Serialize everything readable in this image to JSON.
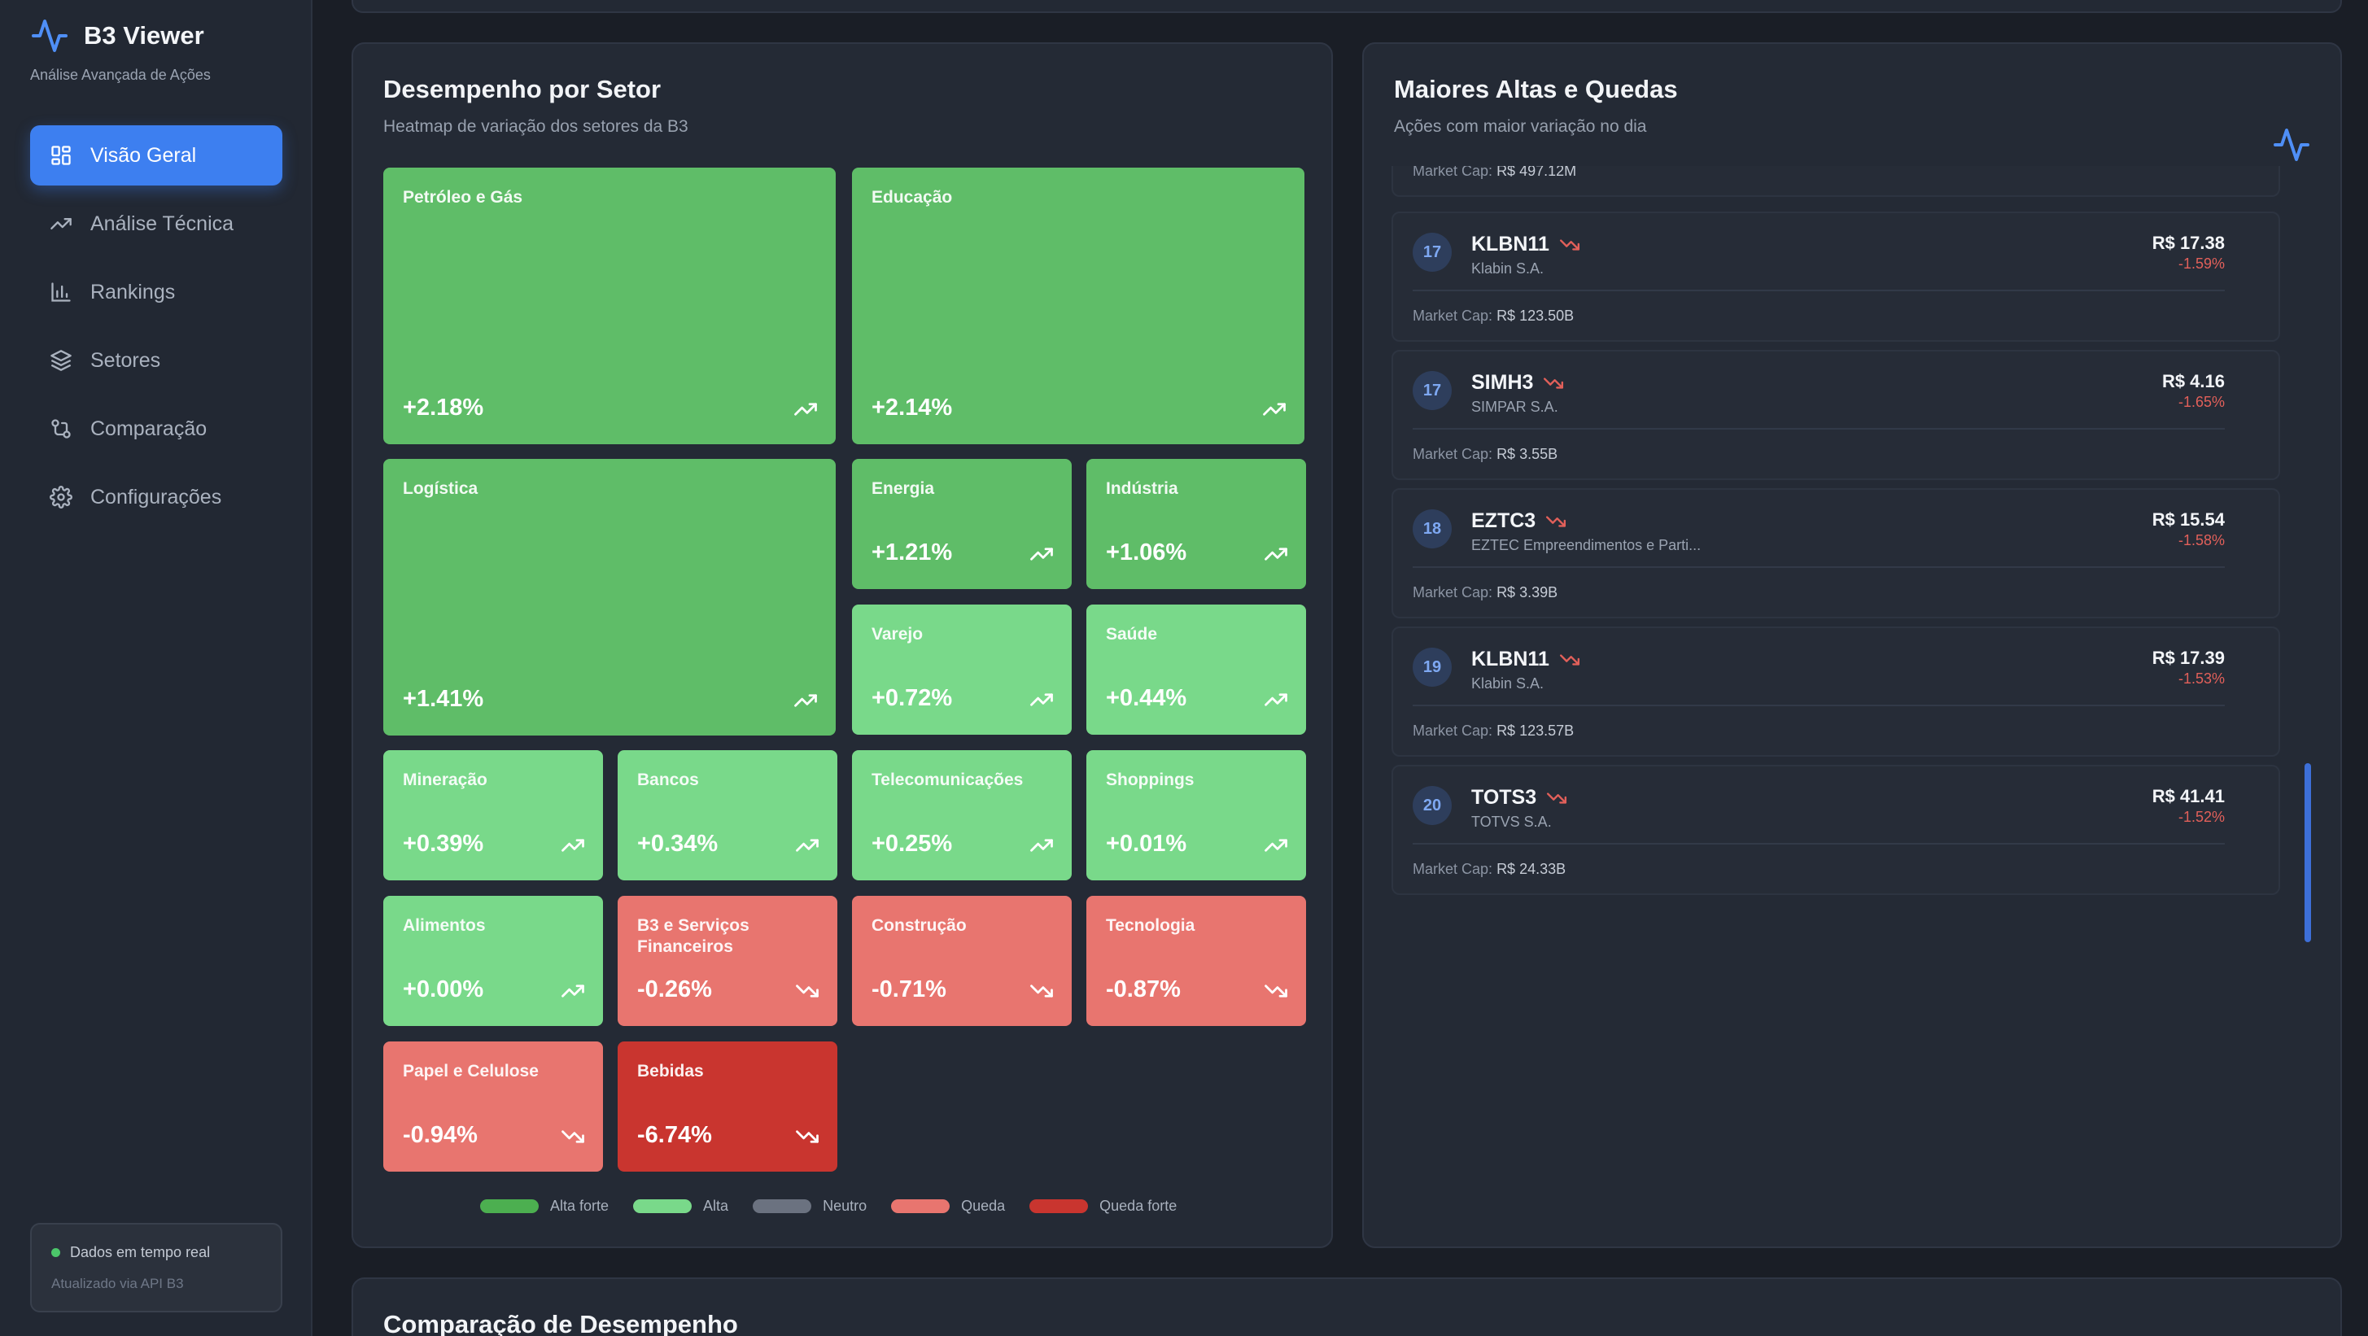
{
  "brand": {
    "title": "B3 Viewer",
    "subtitle": "Análise Avançada de Ações"
  },
  "nav": [
    {
      "label": "Visão Geral",
      "icon": "grid-icon",
      "active": true
    },
    {
      "label": "Análise Técnica",
      "icon": "trending-up-icon"
    },
    {
      "label": "Rankings",
      "icon": "bar-chart-icon"
    },
    {
      "label": "Setores",
      "icon": "layers-icon"
    },
    {
      "label": "Comparação",
      "icon": "git-compare-icon"
    },
    {
      "label": "Configurações",
      "icon": "gear-icon"
    }
  ],
  "status": {
    "title": "Dados em tempo real",
    "subtitle": "Atualizado via API B3"
  },
  "heatmap": {
    "title": "Desempenho por Setor",
    "subtitle": "Heatmap de variação dos setores da B3",
    "tiles": [
      {
        "name": "Petróleo e Gás",
        "value": "+2.18%",
        "trend": "up"
      },
      {
        "name": "Educação",
        "value": "+2.14%",
        "trend": "up"
      },
      {
        "name": "Logística",
        "value": "+1.41%",
        "trend": "up"
      },
      {
        "name": "Energia",
        "value": "+1.21%",
        "trend": "up"
      },
      {
        "name": "Indústria",
        "value": "+1.06%",
        "trend": "up"
      },
      {
        "name": "Varejo",
        "value": "+0.72%",
        "trend": "up"
      },
      {
        "name": "Saúde",
        "value": "+0.44%",
        "trend": "up"
      },
      {
        "name": "Mineração",
        "value": "+0.39%",
        "trend": "up"
      },
      {
        "name": "Bancos",
        "value": "+0.34%",
        "trend": "up"
      },
      {
        "name": "Telecomunicações",
        "value": "+0.25%",
        "trend": "up"
      },
      {
        "name": "Shoppings",
        "value": "+0.01%",
        "trend": "up"
      },
      {
        "name": "Alimentos",
        "value": "+0.00%",
        "trend": "up"
      },
      {
        "name": "B3 e Serviços Financeiros",
        "value": "-0.26%",
        "trend": "down"
      },
      {
        "name": "Construção",
        "value": "-0.71%",
        "trend": "down"
      },
      {
        "name": "Tecnologia",
        "value": "-0.87%",
        "trend": "down"
      },
      {
        "name": "Papel e Celulose",
        "value": "-0.94%",
        "trend": "down"
      },
      {
        "name": "Bebidas",
        "value": "-6.74%",
        "trend": "down"
      }
    ],
    "legend": [
      {
        "label": "Alta forte",
        "color": "#4caf50"
      },
      {
        "label": "Alta",
        "color": "#79d98a"
      },
      {
        "label": "Neutro",
        "color": "#6b7280"
      },
      {
        "label": "Queda",
        "color": "#e8756f"
      },
      {
        "label": "Queda forte",
        "color": "#c9352f"
      }
    ]
  },
  "movers": {
    "title": "Maiores Altas e Quedas",
    "subtitle": "Ações com maior variação no dia",
    "market_cap_label": "Market Cap:",
    "partial_market_cap": "R$ 497.12M",
    "items": [
      {
        "rank": "17",
        "ticker": "KLBN11",
        "company": "Klabin S.A.",
        "price": "R$ 17.38",
        "change": "-1.59%",
        "market_cap": "R$ 123.50B"
      },
      {
        "rank": "17",
        "ticker": "SIMH3",
        "company": "SIMPAR S.A.",
        "price": "R$ 4.16",
        "change": "-1.65%",
        "market_cap": "R$ 3.55B"
      },
      {
        "rank": "18",
        "ticker": "EZTC3",
        "company": "EZTEC Empreendimentos e Parti...",
        "price": "R$ 15.54",
        "change": "-1.58%",
        "market_cap": "R$ 3.39B"
      },
      {
        "rank": "19",
        "ticker": "KLBN11",
        "company": "Klabin S.A.",
        "price": "R$ 17.39",
        "change": "-1.53%",
        "market_cap": "R$ 123.57B"
      },
      {
        "rank": "20",
        "ticker": "TOTS3",
        "company": "TOTVS S.A.",
        "price": "R$ 41.41",
        "change": "-1.52%",
        "market_cap": "R$ 24.33B"
      }
    ]
  },
  "comparison": {
    "title": "Comparação de Desempenho"
  }
}
